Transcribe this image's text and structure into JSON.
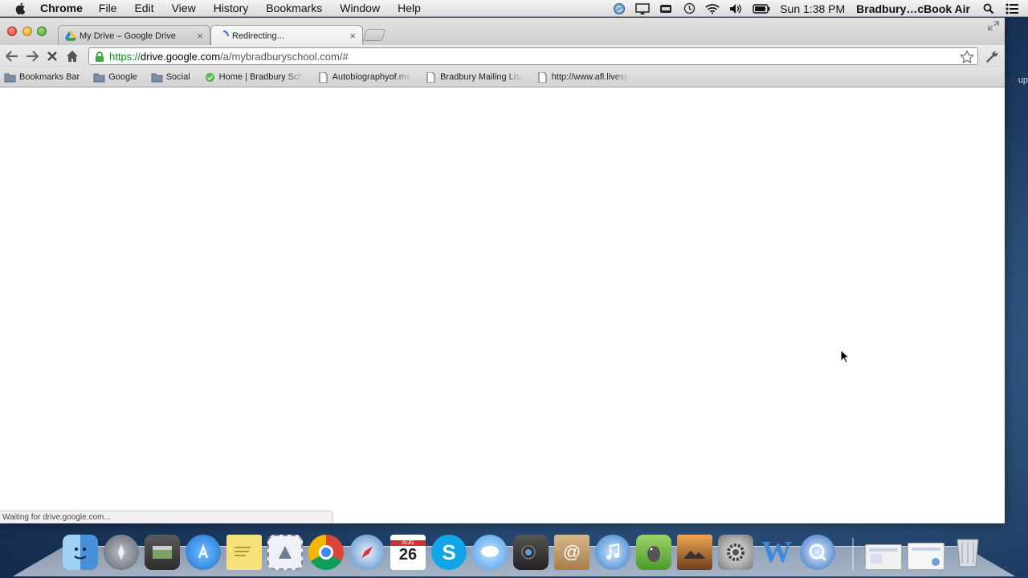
{
  "menubar": {
    "app_name": "Chrome",
    "items": [
      "File",
      "Edit",
      "View",
      "History",
      "Bookmarks",
      "Window",
      "Help"
    ],
    "clock": "Sun 1:38 PM",
    "user": "Bradbury…cBook Air"
  },
  "desktop": {
    "edge_text": "up"
  },
  "tabs": [
    {
      "label": "My Drive – Google Drive",
      "icon": "google-drive-icon",
      "close": "×"
    },
    {
      "label": "Redirecting...",
      "icon": "loading-spinner-icon",
      "close": "×"
    }
  ],
  "omnibox": {
    "scheme": "https://",
    "host": "drive.google.com",
    "path": "/a/mybradburyschool.com/#"
  },
  "bookmarks": [
    {
      "label": "Bookmarks Bar",
      "icon": "folder-icon"
    },
    {
      "label": "Google",
      "icon": "folder-icon"
    },
    {
      "label": "Social",
      "icon": "folder-icon"
    },
    {
      "label": "Home | Bradbury Sch",
      "icon": "bradbury-favicon-icon"
    },
    {
      "label": "Autobiographyof.me",
      "icon": "page-icon"
    },
    {
      "label": "Bradbury Mailing List",
      "icon": "page-icon"
    },
    {
      "label": "http://www.afl.livesp",
      "icon": "page-icon"
    }
  ],
  "status": "Waiting for drive.google.com...",
  "dock": [
    "finder-icon",
    "launchpad-icon",
    "image-capture-icon",
    "app-store-icon",
    "stickies-icon",
    "mail-stamp-icon",
    "chrome-icon",
    "safari-icon",
    "calendar-icon",
    "skype-icon",
    "messages-icon",
    "facetime-icon",
    "address-book-icon",
    "itunes-icon",
    "evernote-icon",
    "iphoto-icon",
    "system-preferences-icon",
    "word-icon",
    "quicktime-icon"
  ],
  "calendar": {
    "month": "AUG",
    "day": "26"
  },
  "colors": {
    "url_scheme": "#0a8a1a",
    "window_bg": "#ffffff",
    "desktop": "#2a4f7a"
  }
}
